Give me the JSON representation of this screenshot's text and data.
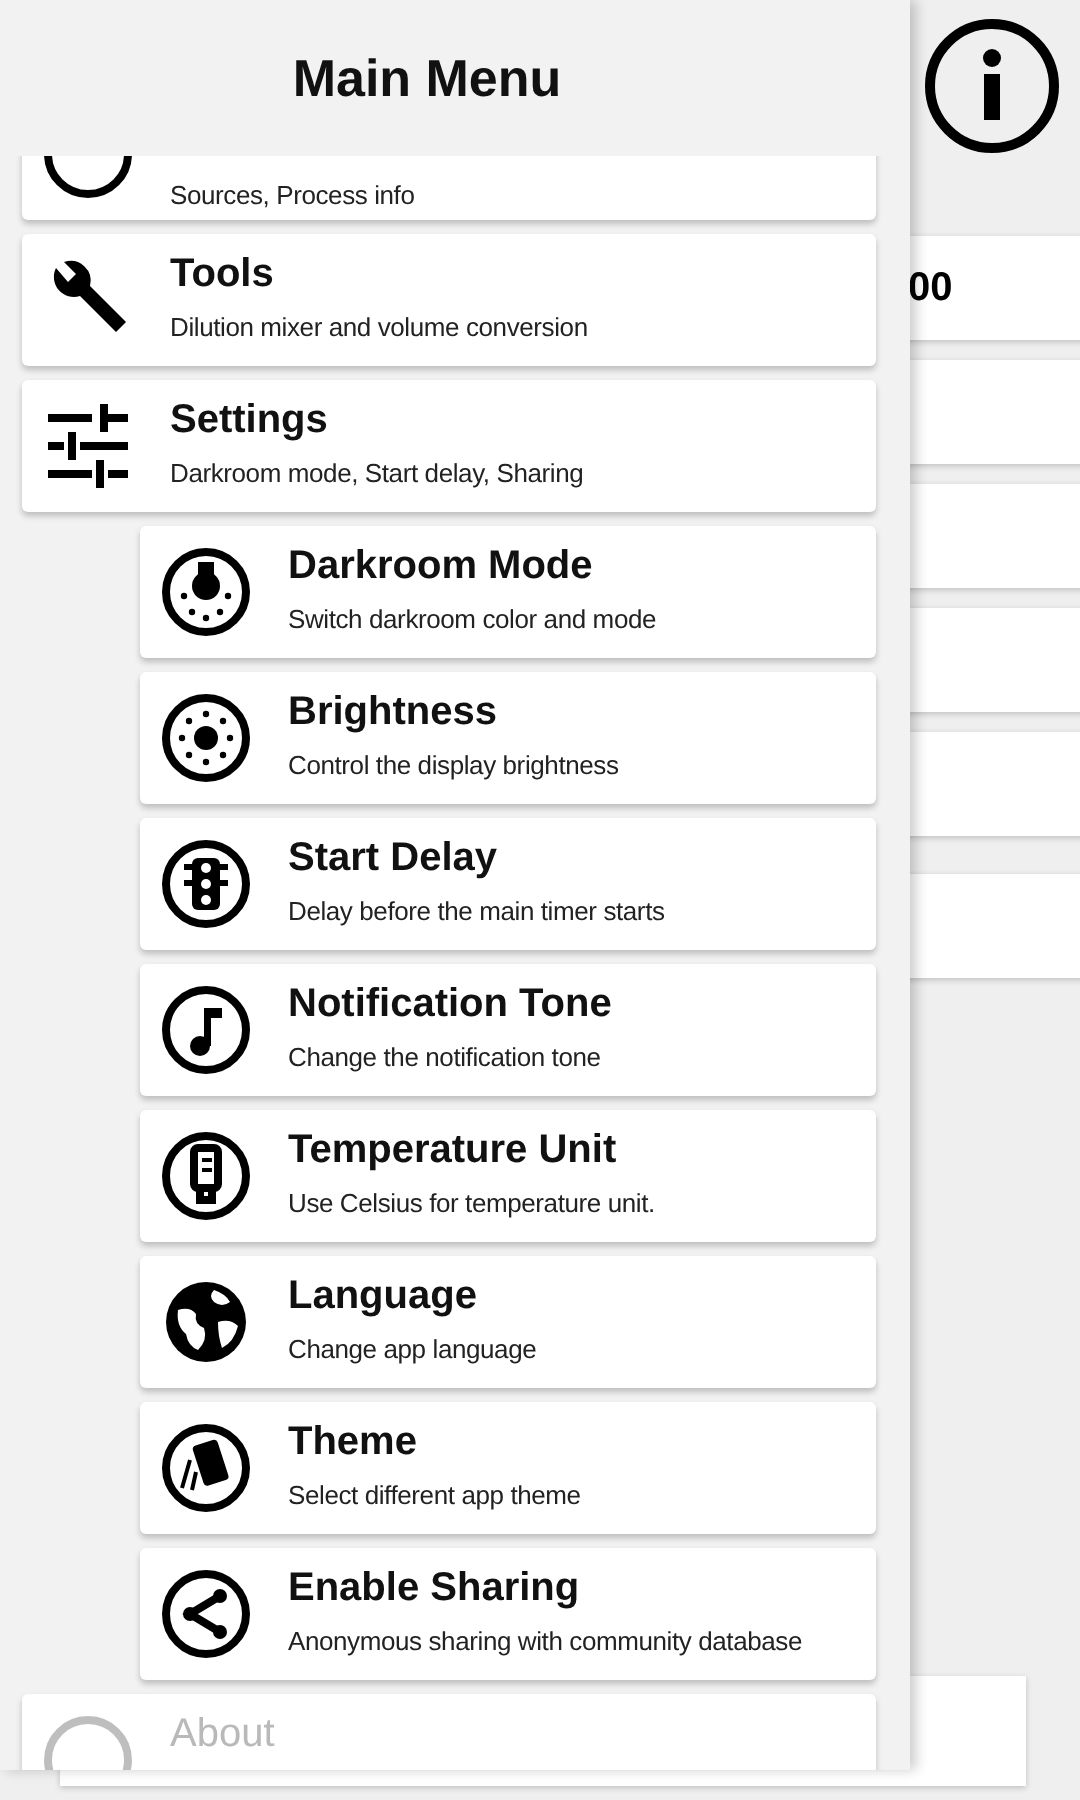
{
  "header": {
    "title": "Main Menu"
  },
  "menu": [
    {
      "subtitle": "Sources, Process info"
    },
    {
      "title": "Tools",
      "subtitle": "Dilution mixer and volume conversion"
    },
    {
      "title": "Settings",
      "subtitle": "Darkroom mode, Start delay, Sharing",
      "children": [
        {
          "title": "Darkroom Mode",
          "subtitle": "Switch darkroom color and mode"
        },
        {
          "title": "Brightness",
          "subtitle": "Control the display brightness"
        },
        {
          "title": "Start Delay",
          "subtitle": "Delay before the main timer starts"
        },
        {
          "title": "Notification Tone",
          "subtitle": "Change the notification tone"
        },
        {
          "title": "Temperature Unit",
          "subtitle": "Use Celsius for temperature unit."
        },
        {
          "title": "Language",
          "subtitle": "Change app language"
        },
        {
          "title": "Theme",
          "subtitle": "Select different app theme"
        },
        {
          "title": "Enable Sharing",
          "subtitle": "Anonymous sharing with community database"
        }
      ]
    },
    {
      "title": "About"
    }
  ],
  "background_app": {
    "field_value": "00"
  }
}
